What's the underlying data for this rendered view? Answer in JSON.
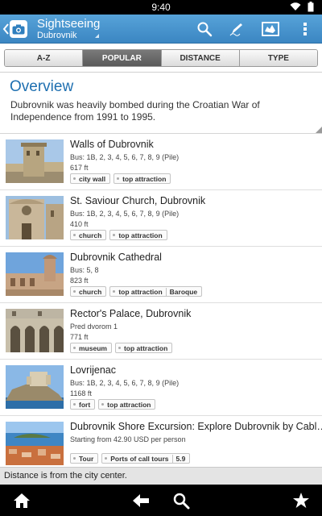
{
  "status_bar": {
    "time": "9:40"
  },
  "action_bar": {
    "title": "Sightseeing",
    "subtitle": "Dubrovnik",
    "icons": [
      "back-chevron-icon",
      "camera-icon",
      "search-icon",
      "pen-icon",
      "map-icon",
      "overflow-menu-icon"
    ]
  },
  "tabs": [
    {
      "label": "A-Z",
      "active": false
    },
    {
      "label": "POPULAR",
      "active": true
    },
    {
      "label": "DISTANCE",
      "active": false
    },
    {
      "label": "TYPE",
      "active": false
    }
  ],
  "overview": {
    "heading": "Overview",
    "text": "Dubrovnik was heavily bombed during the Croatian War of Independence from 1991 to 1995."
  },
  "places": [
    {
      "title": "Walls of Dubrovnik",
      "line1": "Bus: 1B, 2, 3, 4, 5, 6, 7, 8, 9 (Pile)",
      "line2": "617 ft",
      "tags": [
        "city wall",
        "top attraction"
      ]
    },
    {
      "title": "St. Saviour Church, Dubrovnik",
      "line1": "Bus: 1B, 2, 3, 4, 5, 6, 7, 8, 9 (Pile)",
      "line2": "410 ft",
      "tags": [
        "church",
        "top attraction"
      ]
    },
    {
      "title": "Dubrovnik Cathedral",
      "line1": "Bus: 5, 8",
      "line2": "823 ft",
      "tags": [
        "church",
        "top attraction",
        "Baroque"
      ]
    },
    {
      "title": "Rector's Palace, Dubrovnik",
      "line1": "Pred dvorom 1",
      "line2": "771 ft",
      "tags": [
        "museum",
        "top attraction"
      ]
    },
    {
      "title": "Lovrijenac",
      "line1": "Bus: 1B, 2, 3, 4, 5, 6, 7, 8, 9 (Pile)",
      "line2": "1168 ft",
      "tags": [
        "fort",
        "top attraction"
      ]
    },
    {
      "title": "Dubrovnik Shore Excursion: Explore Dubrovnik by Cabl…",
      "line1": "Starting from 42.90 USD per person",
      "line2": "",
      "tags": [
        "Tour",
        "Ports of call tours",
        "5.9"
      ]
    }
  ],
  "footer_note": "Distance is from the city center.",
  "nav_bar": {
    "icons": [
      "home-icon",
      "back-arrow-icon",
      "search-icon",
      "star-icon"
    ]
  },
  "colors": {
    "action_bar": "#4a97cf",
    "overview_heading": "#1e6fb0",
    "active_tab": "#666666"
  }
}
